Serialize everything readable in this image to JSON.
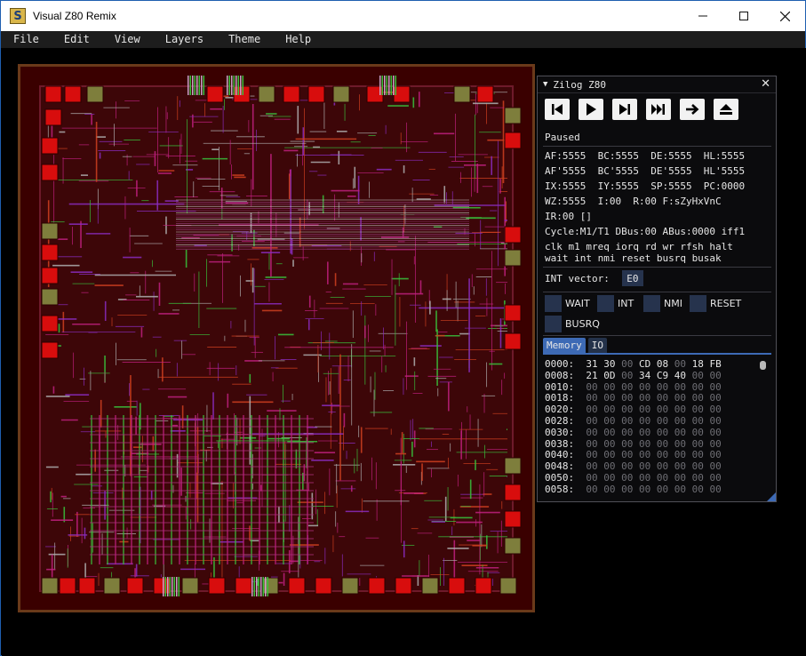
{
  "window": {
    "title": "Visual Z80 Remix"
  },
  "menu": [
    "File",
    "Edit",
    "View",
    "Layers",
    "Theme",
    "Help"
  ],
  "colors": {
    "accent": "#3d6ab5",
    "pin_off": "#26334d",
    "die_bg": "#3a0000",
    "metal": "#c0207f",
    "poly": "#39c23c",
    "pad": "#d80d0d"
  },
  "panel": {
    "title": "Zilog Z80",
    "toolbar_icons": [
      "skip-to-start-icon",
      "play-icon",
      "step-icon",
      "fast-forward-icon",
      "arrow-right-icon",
      "eject-icon"
    ],
    "status": "Paused",
    "registers": [
      "AF:5555  BC:5555  DE:5555  HL:5555",
      "AF'5555  BC'5555  DE'5555  HL'5555",
      "IX:5555  IY:5555  SP:5555  PC:0000",
      "WZ:5555  I:00  R:00 F:sZyHxVnC",
      "IR:00 []"
    ],
    "cycle": "Cycle:M1/T1 DBus:00 ABus:0000 iff1",
    "signals": [
      "clk m1 mreq iorq rd wr rfsh halt",
      "wait int nmi reset busrq busak"
    ],
    "int_vector_label": "INT vector:",
    "int_vector_value": "E0",
    "pins": [
      "WAIT",
      "INT",
      "NMI",
      "RESET",
      "BUSRQ"
    ],
    "tabs": [
      "Memory",
      "IO"
    ],
    "active_tab": "Memory",
    "memory": [
      {
        "addr": "0000:",
        "bytes": [
          "31",
          "30",
          "00",
          "CD",
          "08",
          "00",
          "18",
          "FB"
        ]
      },
      {
        "addr": "0008:",
        "bytes": [
          "21",
          "0D",
          "00",
          "34",
          "C9",
          "40",
          "00",
          "00"
        ]
      },
      {
        "addr": "0010:",
        "bytes": [
          "00",
          "00",
          "00",
          "00",
          "00",
          "00",
          "00",
          "00"
        ]
      },
      {
        "addr": "0018:",
        "bytes": [
          "00",
          "00",
          "00",
          "00",
          "00",
          "00",
          "00",
          "00"
        ]
      },
      {
        "addr": "0020:",
        "bytes": [
          "00",
          "00",
          "00",
          "00",
          "00",
          "00",
          "00",
          "00"
        ]
      },
      {
        "addr": "0028:",
        "bytes": [
          "00",
          "00",
          "00",
          "00",
          "00",
          "00",
          "00",
          "00"
        ]
      },
      {
        "addr": "0030:",
        "bytes": [
          "00",
          "00",
          "00",
          "00",
          "00",
          "00",
          "00",
          "00"
        ]
      },
      {
        "addr": "0038:",
        "bytes": [
          "00",
          "00",
          "00",
          "00",
          "00",
          "00",
          "00",
          "00"
        ]
      },
      {
        "addr": "0040:",
        "bytes": [
          "00",
          "00",
          "00",
          "00",
          "00",
          "00",
          "00",
          "00"
        ]
      },
      {
        "addr": "0048:",
        "bytes": [
          "00",
          "00",
          "00",
          "00",
          "00",
          "00",
          "00",
          "00"
        ]
      },
      {
        "addr": "0050:",
        "bytes": [
          "00",
          "00",
          "00",
          "00",
          "00",
          "00",
          "00",
          "00"
        ]
      },
      {
        "addr": "0058:",
        "bytes": [
          "00",
          "00",
          "00",
          "00",
          "00",
          "00",
          "00",
          "00"
        ]
      }
    ]
  }
}
